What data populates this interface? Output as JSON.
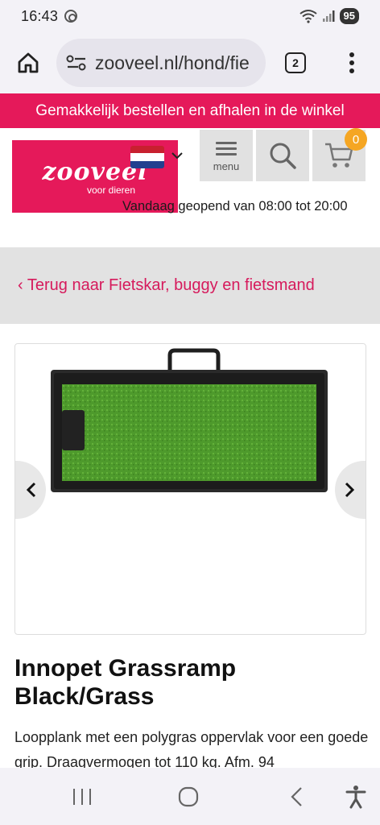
{
  "status_bar": {
    "time": "16:43",
    "battery": "95"
  },
  "browser": {
    "url": "zooveel.nl/hond/fie",
    "tab_count": "2"
  },
  "promo_banner": "Gemakkelijk bestellen en afhalen in de winkel",
  "header": {
    "logo_name": "zooveel",
    "logo_sub": "voor dieren",
    "menu_label": "menu",
    "cart_count": "0",
    "opening_hours": "Vandaag geopend van 08:00 tot 20:00"
  },
  "breadcrumb": "‹ Terug naar Fietskar, buggy en fietsmand",
  "product": {
    "title": "Innopet Grassramp Black/Grass",
    "description": "Loopplank met een polygras oppervlak voor een goede grip. Draagvermogen tot 110 kg. Afm. 94"
  },
  "colors": {
    "brand": "#e5195a",
    "badge": "#f5a623",
    "grass": "#4e9a2c"
  },
  "icons": [
    "home-icon",
    "site-settings-icon",
    "tabs-icon",
    "more-vert-icon",
    "flag-nl-icon",
    "chevron-down-icon",
    "menu-icon",
    "search-icon",
    "cart-icon",
    "chevron-left-icon",
    "chevron-right-icon",
    "recents-icon",
    "home-circle-icon",
    "back-icon",
    "accessibility-icon"
  ]
}
